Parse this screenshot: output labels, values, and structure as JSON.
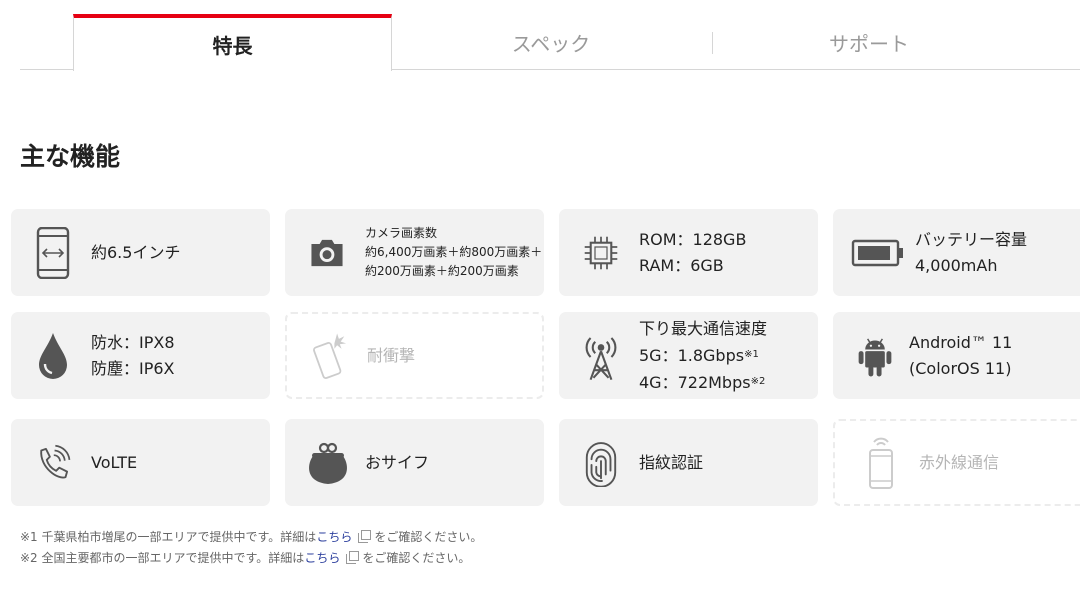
{
  "tabs": {
    "features": "特長",
    "specs": "スペック",
    "support": "サポート"
  },
  "section_title": "主な機能",
  "cards": {
    "display": {
      "line1": "約6.5インチ"
    },
    "camera": {
      "line1": "カメラ画素数",
      "line2": "約6,400万画素＋約800万画素＋",
      "line3": "約200万画素＋約200万画素"
    },
    "memory": {
      "line1": "ROM：128GB",
      "line2": "RAM：6GB"
    },
    "battery": {
      "line1": "バッテリー容量",
      "line2": "4,000mAh"
    },
    "water": {
      "line1": "防水：IPX8",
      "line2": "防塵：IP6X"
    },
    "shock": {
      "line1": "耐衝撃"
    },
    "speed": {
      "line1": "下り最大通信速度",
      "line2": "5G：1.8Gbps",
      "note2": "※1",
      "line3": "4G：722Mbps",
      "note3": "※2"
    },
    "os": {
      "line1": "Android™ 11",
      "line2": "(ColorOS 11)"
    },
    "volte": {
      "line1": "VoLTE"
    },
    "wallet": {
      "line1": "おサイフ"
    },
    "fingerprint": {
      "line1": "指紋認証"
    },
    "infrared": {
      "line1": "赤外線通信"
    }
  },
  "notes": {
    "note1_prefix": "※1 千葉県柏市増尾の一部エリアで提供中です。詳細は",
    "note2_prefix": "※2 全国主要都市の一部エリアで提供中です。詳細は",
    "link_label": "こちら",
    "suffix": "をご確認ください。"
  },
  "colors": {
    "accent": "#e60012",
    "icon": "#555555",
    "icon_disabled": "#cccccc",
    "link": "#2a3d9c"
  },
  "icons": [
    "smartphone-size-icon",
    "camera-icon",
    "chip-icon",
    "battery-icon",
    "water-drop-icon",
    "shock-phone-icon",
    "antenna-icon",
    "android-icon",
    "phone-call-icon",
    "wallet-purse-icon",
    "fingerprint-icon",
    "infrared-phone-icon"
  ]
}
